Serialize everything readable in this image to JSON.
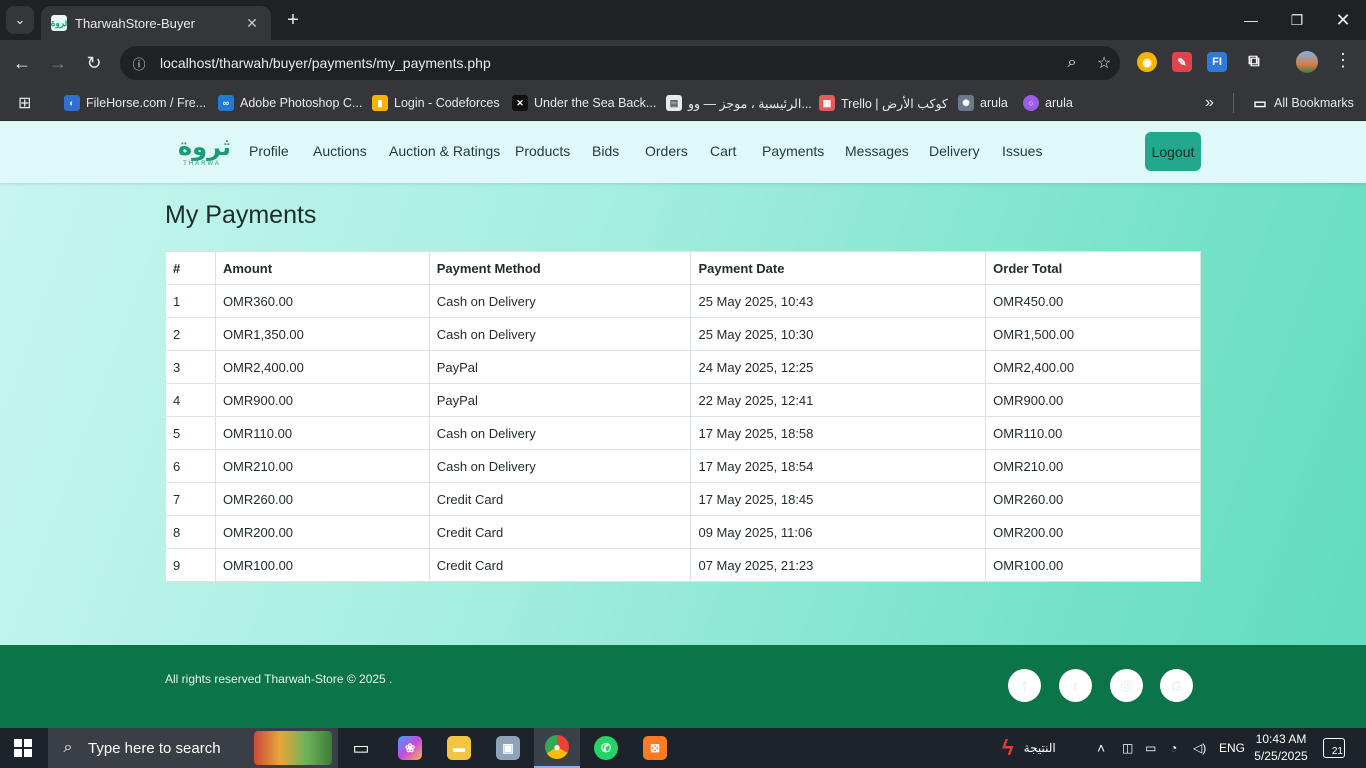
{
  "browser": {
    "tab_title": "TharwahStore-Buyer",
    "tab_favicon_text": "ثروة",
    "url": "localhost/tharwah/buyer/payments/my_payments.php",
    "bookmarks": [
      "FileHorse.com / Fre...",
      "Adobe Photoshop C...",
      "Login - Codeforces",
      "Under the Sea Back...",
      "الرئيسية ، موجز — وو...",
      "Trello | كوكب الأرض",
      "arula",
      "arula"
    ],
    "all_bookmarks_label": "All Bookmarks",
    "colors": {
      "frame": "#202124",
      "toolbar": "#35363a"
    }
  },
  "site": {
    "logo_text": "ثروة",
    "logo_sub": "THARWA",
    "nav": [
      "Profile",
      "Auctions",
      "Auction & Ratings",
      "Products",
      "Bids",
      "Orders",
      "Cart",
      "Payments",
      "Messages",
      "Delivery",
      "Issues"
    ],
    "logout_label": "Logout",
    "colors": {
      "accent": "#22a88a",
      "footer": "#0b7448",
      "nav_bg": "#dff9f8"
    }
  },
  "main": {
    "title": "My Payments",
    "columns": [
      "#",
      "Amount",
      "Payment Method",
      "Payment Date",
      "Order Total"
    ],
    "rows": [
      [
        "1",
        "OMR360.00",
        "Cash on Delivery",
        "25 May 2025, 10:43",
        "OMR450.00"
      ],
      [
        "2",
        "OMR1,350.00",
        "Cash on Delivery",
        "25 May 2025, 10:30",
        "OMR1,500.00"
      ],
      [
        "3",
        "OMR2,400.00",
        "PayPal",
        "24 May 2025, 12:25",
        "OMR2,400.00"
      ],
      [
        "4",
        "OMR900.00",
        "PayPal",
        "22 May 2025, 12:41",
        "OMR900.00"
      ],
      [
        "5",
        "OMR110.00",
        "Cash on Delivery",
        "17 May 2025, 18:58",
        "OMR110.00"
      ],
      [
        "6",
        "OMR210.00",
        "Cash on Delivery",
        "17 May 2025, 18:54",
        "OMR210.00"
      ],
      [
        "7",
        "OMR260.00",
        "Credit Card",
        "17 May 2025, 18:45",
        "OMR260.00"
      ],
      [
        "8",
        "OMR200.00",
        "Credit Card",
        "09 May 2025, 11:06",
        "OMR200.00"
      ],
      [
        "9",
        "OMR100.00",
        "Credit Card",
        "07 May 2025, 21:23",
        "OMR100.00"
      ]
    ]
  },
  "footer": {
    "text": "All rights reserved Tharwah-Store © 2025 .",
    "social_icons": [
      "facebook-icon",
      "twitter-icon",
      "instagram-icon",
      "google-icon"
    ]
  },
  "taskbar": {
    "search_placeholder": "Type here to search",
    "weather_label": "النتيجة",
    "language": "ENG",
    "time": "10:43 AM",
    "date": "5/25/2025",
    "notification_count": "21"
  }
}
